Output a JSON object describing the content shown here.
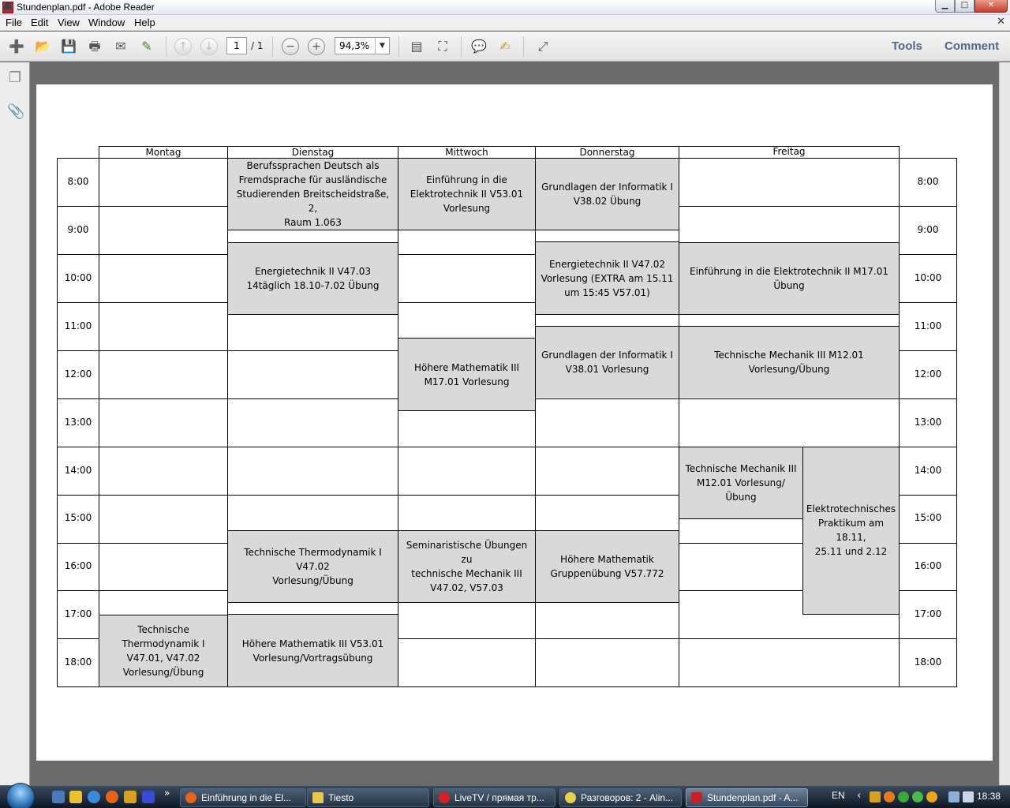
{
  "window": {
    "title": "Stundenplan.pdf - Adobe Reader",
    "app_icon": "pdf-icon",
    "min": "▁",
    "max": "□",
    "close": "✕"
  },
  "menu": {
    "items": [
      "File",
      "Edit",
      "View",
      "Window",
      "Help"
    ],
    "close": "✕"
  },
  "toolbar": {
    "page_current": "1",
    "page_total": "/ 1",
    "zoom": "94,3%",
    "zoom_arrow": "▼",
    "tools": "Tools",
    "comment": "Comment",
    "icons": {
      "create": "➕",
      "open": "📂",
      "save": "💾",
      "print": "🖶",
      "email": "✉",
      "review": "✎",
      "prev": "↑",
      "next": "↓",
      "zoom_out": "−",
      "zoom_in": "+",
      "fit_page": "▤",
      "fit_width": "⛶",
      "sticky_note": "💬",
      "highlight": "✍",
      "expand": "⤢"
    }
  },
  "leftnav": {
    "pages_icon": "❐",
    "attach_icon": "📎"
  },
  "timetable": {
    "days": [
      "Montag",
      "Dienstag",
      "Mittwoch",
      "Donnerstag",
      "Freitag"
    ],
    "times": [
      "8:00",
      "9:00",
      "10:00",
      "11:00",
      "12:00",
      "13:00",
      "14:00",
      "15:00",
      "16:00",
      "17:00",
      "18:00"
    ],
    "events": [
      {
        "id": "di-berufssprachen",
        "text": "Berufssprachen Deutsch als\nFremdsprache für ausländische\nStudierenden Breitscheidstraße, 2,\nRaum 1.063"
      },
      {
        "id": "mi-einfuehrung-et",
        "text": "Einführung in die\nElektrotechnik II          V53.01\nVorlesung"
      },
      {
        "id": "do-informatik-uebung",
        "text": "Grundlagen der Informatik I\nV38.02 Übung"
      },
      {
        "id": "di-energietechnik",
        "text": "Energietechnik II                 V47.03\n14täglich 18.10-7.02 Übung"
      },
      {
        "id": "do-energietechnik",
        "text": "Energietechnik II          V47.02\nVorlesung (EXTRA am 15.11\num 15:45 V57.01)"
      },
      {
        "id": "fr-einfuehrung-et",
        "text": "Einführung in die Elektrotechnik II          M17.01\nÜbung"
      },
      {
        "id": "mi-hoehere-mathe",
        "text": "Höhere Mathematik III\nM17.01 Vorlesung"
      },
      {
        "id": "do-informatik-vorlesung",
        "text": "Grundlagen der Informatik I\nV38.01 Vorlesung"
      },
      {
        "id": "fr-mechanik",
        "text": "Technische Mechanik III                       M12.01\nVorlesung/Übung"
      },
      {
        "id": "fr-mechanik-14",
        "text": "Technische Mechanik III\nM12.01 Vorlesung/Übung"
      },
      {
        "id": "fr-praktikum",
        "text": "Elektrotechnisches\nPraktikum am 18.11,\n25.11 und 2.12"
      },
      {
        "id": "di-thermodynamik",
        "text": "Technische Thermodynamik I V47.02\nVorlesung/Übung"
      },
      {
        "id": "mi-seminar-mechanik",
        "text": "Seminaristische Übungen zu\ntechnische Mechanik III\nV47.02, V57.03"
      },
      {
        "id": "do-mathe-gruppe",
        "text": "Höhere Mathematik\nGruppenübung V57.772"
      },
      {
        "id": "mo-thermodynamik",
        "text": "Technische Thermodynamik I\nV47.01, V47.02\nVorlesung/Übung"
      },
      {
        "id": "di-hoehere-mathe",
        "text": "Höhere Mathematik III          V53.01\nVorlesung/Vortragsübung"
      }
    ]
  },
  "taskbar": {
    "tasks": [
      {
        "label": "Einführung in die El...",
        "icon_color": "#e8631a"
      },
      {
        "label": "Tiesto",
        "icon_color": "#e8c84a"
      },
      {
        "label": "LiveTV / прямая тр...",
        "icon_color": "#d82020"
      },
      {
        "label": "Разговоров: 2 - Alin...",
        "icon_color": "#e8d24a"
      },
      {
        "label": "Stundenplan.pdf - A...",
        "icon_color": "#c8202a"
      }
    ],
    "more": "»",
    "lang": "EN",
    "tray_arrow": "‹",
    "clock": "18:38"
  }
}
